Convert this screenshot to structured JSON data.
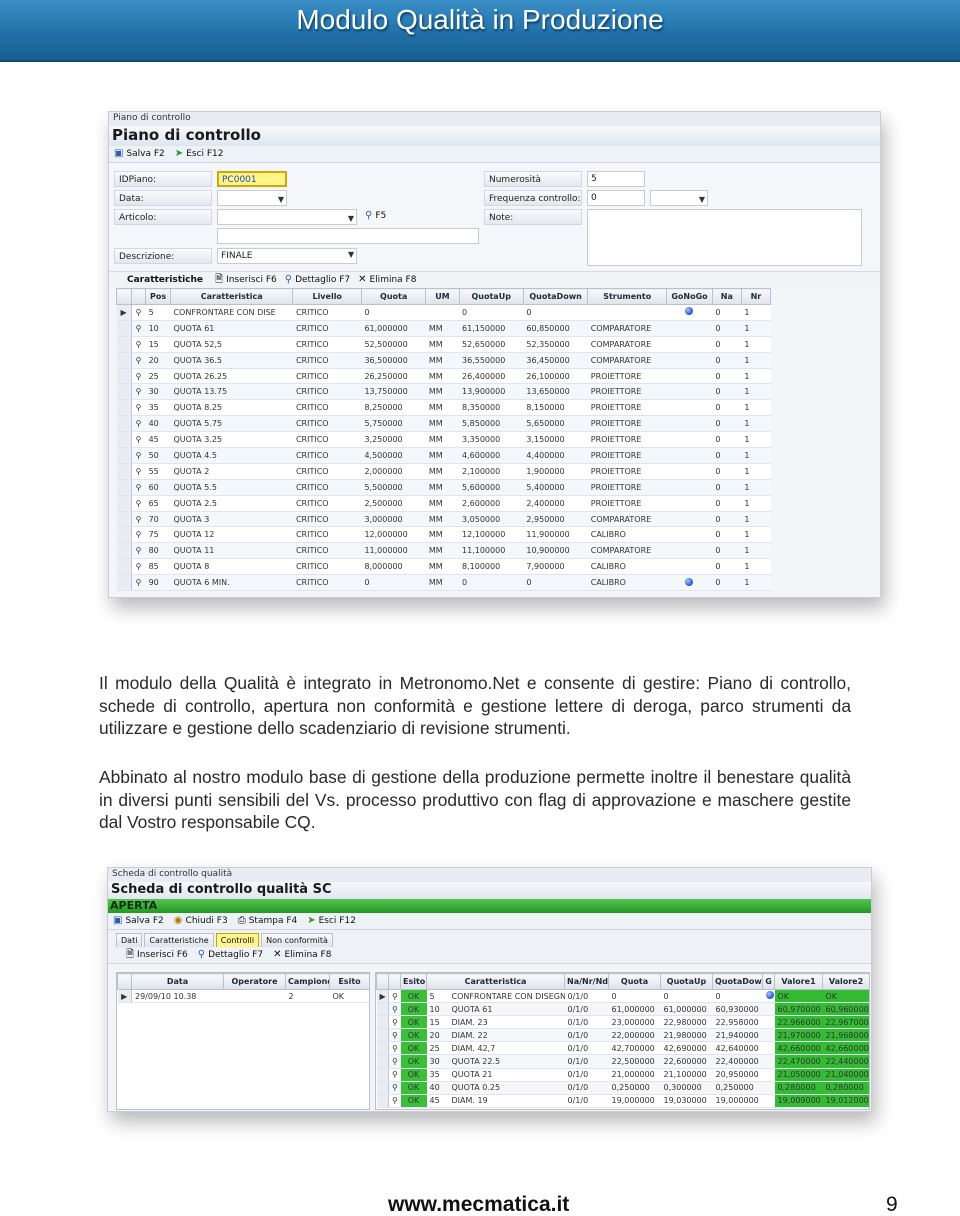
{
  "header": {
    "title": "Modulo Qualità in Produzione"
  },
  "shot1": {
    "caption": "Piano di controllo",
    "title": "Piano di controllo",
    "toolbar": {
      "save": "Salva F2",
      "exit": "Esci F12"
    },
    "form": {
      "id_label": "IDPiano:",
      "id_value": "PC0001",
      "date_label": "Data:",
      "article_label": "Articolo:",
      "f5": "F5",
      "desc_label": "Descrizione:",
      "desc_value": "FINALE",
      "sample_label": "Numerosità campione:",
      "sample_value": "5",
      "freq_label": "Frequenza controllo:",
      "freq_value": "0",
      "note_label": "Note:"
    },
    "grid_toolbar": {
      "title": "Caratteristiche",
      "insert": "Inserisci F6",
      "detail": "Dettaglio F7",
      "delete": "Elimina F8"
    },
    "columns": [
      "Pos",
      "Caratteristica",
      "Livello",
      "Quota",
      "UM",
      "QuotaUp",
      "QuotaDown",
      "Strumento",
      "GoNoGo",
      "Na",
      "Nr"
    ],
    "rows": [
      [
        "5",
        "CONFRONTARE CON DISE",
        "CRITICO",
        "0",
        "",
        "0",
        "0",
        "",
        "dot",
        "0",
        "1"
      ],
      [
        "10",
        "QUOTA 61",
        "CRITICO",
        "61,000000",
        "MM",
        "61,150000",
        "60,850000",
        "COMPARATORE",
        "",
        "0",
        "1"
      ],
      [
        "15",
        "QUOTA 52,5",
        "CRITICO",
        "52,500000",
        "MM",
        "52,650000",
        "52,350000",
        "COMPARATORE",
        "",
        "0",
        "1"
      ],
      [
        "20",
        "QUOTA 36.5",
        "CRITICO",
        "36,500000",
        "MM",
        "36,550000",
        "36,450000",
        "COMPARATORE",
        "",
        "0",
        "1"
      ],
      [
        "25",
        "QUOTA 26.25",
        "CRITICO",
        "26,250000",
        "MM",
        "26,400000",
        "26,100000",
        "PROIETTORE",
        "",
        "0",
        "1"
      ],
      [
        "30",
        "QUOTA 13.75",
        "CRITICO",
        "13,750000",
        "MM",
        "13,900000",
        "13,650000",
        "PROIETTORE",
        "",
        "0",
        "1"
      ],
      [
        "35",
        "QUOTA 8.25",
        "CRITICO",
        "8,250000",
        "MM",
        "8,350000",
        "8,150000",
        "PROIETTORE",
        "",
        "0",
        "1"
      ],
      [
        "40",
        "QUOTA 5.75",
        "CRITICO",
        "5,750000",
        "MM",
        "5,850000",
        "5,650000",
        "PROIETTORE",
        "",
        "0",
        "1"
      ],
      [
        "45",
        "QUOTA 3.25",
        "CRITICO",
        "3,250000",
        "MM",
        "3,350000",
        "3,150000",
        "PROIETTORE",
        "",
        "0",
        "1"
      ],
      [
        "50",
        "QUOTA 4.5",
        "CRITICO",
        "4,500000",
        "MM",
        "4,600000",
        "4,400000",
        "PROIETTORE",
        "",
        "0",
        "1"
      ],
      [
        "55",
        "QUOTA 2",
        "CRITICO",
        "2,000000",
        "MM",
        "2,100000",
        "1,900000",
        "PROIETTORE",
        "",
        "0",
        "1"
      ],
      [
        "60",
        "QUOTA 5.5",
        "CRITICO",
        "5,500000",
        "MM",
        "5,600000",
        "5,400000",
        "PROIETTORE",
        "",
        "0",
        "1"
      ],
      [
        "65",
        "QUOTA 2.5",
        "CRITICO",
        "2,500000",
        "MM",
        "2,600000",
        "2,400000",
        "PROIETTORE",
        "",
        "0",
        "1"
      ],
      [
        "70",
        "QUOTA 3",
        "CRITICO",
        "3,000000",
        "MM",
        "3,050000",
        "2,950000",
        "COMPARATORE",
        "",
        "0",
        "1"
      ],
      [
        "75",
        "QUOTA 12",
        "CRITICO",
        "12,000000",
        "MM",
        "12,100000",
        "11,900000",
        "CALIBRO",
        "",
        "0",
        "1"
      ],
      [
        "80",
        "QUOTA 11",
        "CRITICO",
        "11,000000",
        "MM",
        "11,100000",
        "10,900000",
        "COMPARATORE",
        "",
        "0",
        "1"
      ],
      [
        "85",
        "QUOTA 8",
        "CRITICO",
        "8,000000",
        "MM",
        "8,100000",
        "7,900000",
        "CALIBRO",
        "",
        "0",
        "1"
      ],
      [
        "90",
        "QUOTA 6 MIN.",
        "CRITICO",
        "0",
        "MM",
        "0",
        "0",
        "CALIBRO",
        "dot",
        "0",
        "1"
      ]
    ]
  },
  "text": {
    "p1": "Il modulo della Qualità è integrato in Metronomo.Net e consente di gestire: Piano di controllo, schede di controllo, apertura non conformità e gestione lettere di deroga, parco strumenti da utilizzare e gestione dello scadenziario di revisione strumenti.",
    "p2": "Abbinato al nostro modulo base di gestione della produzione permette inoltre il benestare qualità in diversi punti sensibili del Vs. processo produttivo con flag di approvazione e maschere gestite dal Vostro responsabile CQ."
  },
  "shot2": {
    "caption": "Scheda di controllo qualità",
    "title": "Scheda di controllo qualità SC",
    "status": "APERTA",
    "toolbar": {
      "save": "Salva F2",
      "close": "Chiudi F3",
      "print": "Stampa F4",
      "exit": "Esci F12"
    },
    "tabs": [
      "Dati",
      "Caratteristiche",
      "Controlli",
      "Non conformità"
    ],
    "grid_toolbar": {
      "insert": "Inserisci F6",
      "detail": "Dettaglio F7",
      "delete": "Elimina F8"
    },
    "left_columns": [
      "Data",
      "Operatore",
      "Campione",
      "Esito"
    ],
    "left_rows": [
      [
        "29/09/10 10.38",
        "",
        "2",
        "OK"
      ]
    ],
    "right_columns": [
      "Esito",
      "Caratteristica",
      "Na/Nr/Nd",
      "Quota",
      "QuotaUp",
      "QuotaDow",
      "G",
      "Valore1",
      "Valore2"
    ],
    "right_rows": [
      [
        "OK",
        "5",
        "CONFRONTARE CON DISEGNO",
        "0/1/0",
        "0",
        "0",
        "0",
        "dot",
        "OK",
        "OK"
      ],
      [
        "OK",
        "10",
        "QUOTA 61",
        "0/1/0",
        "61,000000",
        "61,000000",
        "60,930000",
        "",
        "60,970000",
        "60,960000"
      ],
      [
        "OK",
        "15",
        "DIAM. 23",
        "0/1/0",
        "23,000000",
        "22,980000",
        "22,958000",
        "",
        "22,966000",
        "22,967000"
      ],
      [
        "OK",
        "20",
        "DIAM. 22",
        "0/1/0",
        "22,000000",
        "21,980000",
        "21,940000",
        "",
        "21,970000",
        "21,968000"
      ],
      [
        "OK",
        "25",
        "DIAM. 42,7",
        "0/1/0",
        "42,700000",
        "42,690000",
        "42,640000",
        "",
        "42,660000",
        "42,660000"
      ],
      [
        "OK",
        "30",
        "QUOTA 22.5",
        "0/1/0",
        "22,500000",
        "22,600000",
        "22,400000",
        "",
        "22,470000",
        "22,440000"
      ],
      [
        "OK",
        "35",
        "QUOTA 21",
        "0/1/0",
        "21,000000",
        "21,100000",
        "20,950000",
        "",
        "21,050000",
        "21,040000"
      ],
      [
        "OK",
        "40",
        "QUOTA 0.25",
        "0/1/0",
        "0,250000",
        "0,300000",
        "0,250000",
        "",
        "0,280000",
        "0,280000"
      ],
      [
        "OK",
        "45",
        "DIAM. 19",
        "0/1/0",
        "19,000000",
        "19,030000",
        "19,000000",
        "",
        "19,009000",
        "19,012000"
      ]
    ]
  },
  "footer": {
    "url": "www.mecmatica.it",
    "page": "9"
  }
}
